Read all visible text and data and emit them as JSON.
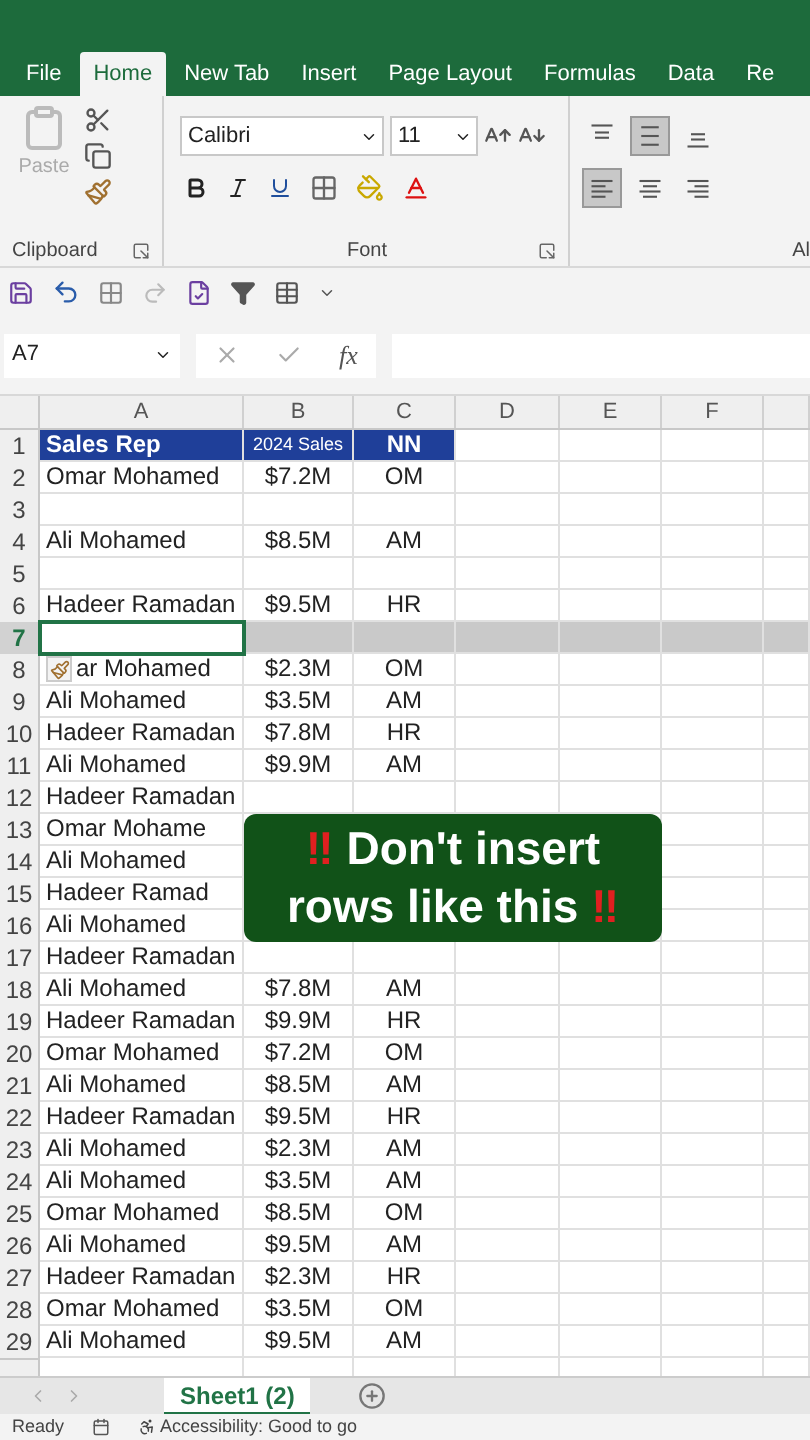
{
  "tabs": [
    {
      "label": "File",
      "selected": false
    },
    {
      "label": "Home",
      "selected": true
    },
    {
      "label": "New Tab",
      "selected": false
    },
    {
      "label": "Insert",
      "selected": false
    },
    {
      "label": "Page Layout",
      "selected": false
    },
    {
      "label": "Formulas",
      "selected": false
    },
    {
      "label": "Data",
      "selected": false
    },
    {
      "label": "Re",
      "selected": false
    }
  ],
  "ribbon": {
    "clipboard": {
      "paste_label": "Paste",
      "paste_disabled": true,
      "group_label": "Clipboard"
    },
    "font": {
      "name": "Calibri",
      "size": "11",
      "group_label": "Font"
    },
    "alignment": {
      "vertical": [
        {
          "kind": "top",
          "selected": false
        },
        {
          "kind": "middle",
          "selected": true
        },
        {
          "kind": "bottom",
          "selected": false
        }
      ],
      "horizontal": [
        {
          "kind": "left",
          "selected": true
        },
        {
          "kind": "center",
          "selected": false
        },
        {
          "kind": "right",
          "selected": false
        }
      ],
      "group_label": "Al"
    }
  },
  "formula_bar": {
    "name_box": "A7",
    "fx": "fx"
  },
  "columns": [
    "A",
    "B",
    "C",
    "D",
    "E",
    "F"
  ],
  "rows": [
    {
      "number": "1",
      "kind": "header",
      "selected": false,
      "cells": [
        "Sales Rep",
        "2024 Sales",
        "NN"
      ]
    },
    {
      "number": "2",
      "kind": "data",
      "selected": false,
      "cells": [
        "Omar Mohamed",
        "$7.2M",
        "OM"
      ]
    },
    {
      "number": "3",
      "kind": "data",
      "selected": false,
      "cells": []
    },
    {
      "number": "4",
      "kind": "data",
      "selected": false,
      "cells": [
        "Ali Mohamed",
        "$8.5M",
        "AM"
      ]
    },
    {
      "number": "5",
      "kind": "data",
      "selected": false,
      "cells": []
    },
    {
      "number": "6",
      "kind": "data",
      "selected": false,
      "cells": [
        "Hadeer Ramadan",
        "$9.5M",
        "HR"
      ]
    },
    {
      "number": "7",
      "kind": "data",
      "selected": true,
      "cells": []
    },
    {
      "number": "8",
      "kind": "marked",
      "selected": false,
      "cells": [
        "ar Mohamed",
        "$2.3M",
        "OM"
      ]
    },
    {
      "number": "9",
      "kind": "data",
      "selected": false,
      "cells": [
        "Ali Mohamed",
        "$3.5M",
        "AM"
      ]
    },
    {
      "number": "10",
      "kind": "data",
      "selected": false,
      "cells": [
        "Hadeer Ramadan",
        "$7.8M",
        "HR"
      ]
    },
    {
      "number": "11",
      "kind": "data",
      "selected": false,
      "cells": [
        "Ali Mohamed",
        "$9.9M",
        "AM"
      ]
    },
    {
      "number": "12",
      "kind": "data",
      "selected": false,
      "cells": [
        "Hadeer Ramadan"
      ]
    },
    {
      "number": "13",
      "kind": "data",
      "selected": false,
      "cells": [
        "Omar Mohame"
      ]
    },
    {
      "number": "14",
      "kind": "data",
      "selected": false,
      "cells": [
        "Ali Mohamed"
      ]
    },
    {
      "number": "15",
      "kind": "data",
      "selected": false,
      "cells": [
        "Hadeer Ramad"
      ]
    },
    {
      "number": "16",
      "kind": "data",
      "selected": false,
      "cells": [
        "Ali Mohamed"
      ]
    },
    {
      "number": "17",
      "kind": "data",
      "selected": false,
      "cells": [
        "Hadeer Ramadan"
      ]
    },
    {
      "number": "18",
      "kind": "data",
      "selected": false,
      "cells": [
        "Ali Mohamed",
        "$7.8M",
        "AM"
      ]
    },
    {
      "number": "19",
      "kind": "data",
      "selected": false,
      "cells": [
        "Hadeer Ramadan",
        "$9.9M",
        "HR"
      ]
    },
    {
      "number": "20",
      "kind": "data",
      "selected": false,
      "cells": [
        "Omar Mohamed",
        "$7.2M",
        "OM"
      ]
    },
    {
      "number": "21",
      "kind": "data",
      "selected": false,
      "cells": [
        "Ali Mohamed",
        "$8.5M",
        "AM"
      ]
    },
    {
      "number": "22",
      "kind": "data",
      "selected": false,
      "cells": [
        "Hadeer Ramadan",
        "$9.5M",
        "HR"
      ]
    },
    {
      "number": "23",
      "kind": "data",
      "selected": false,
      "cells": [
        "Ali Mohamed",
        "$2.3M",
        "AM"
      ]
    },
    {
      "number": "24",
      "kind": "data",
      "selected": false,
      "cells": [
        "Ali Mohamed",
        "$3.5M",
        "AM"
      ]
    },
    {
      "number": "25",
      "kind": "data",
      "selected": false,
      "cells": [
        "Omar Mohamed",
        "$8.5M",
        "OM"
      ]
    },
    {
      "number": "26",
      "kind": "data",
      "selected": false,
      "cells": [
        "Ali Mohamed",
        "$9.5M",
        "AM"
      ]
    },
    {
      "number": "27",
      "kind": "data",
      "selected": false,
      "cells": [
        "Hadeer Ramadan",
        "$2.3M",
        "HR"
      ]
    },
    {
      "number": "28",
      "kind": "data",
      "selected": false,
      "cells": [
        "Omar Mohamed",
        "$3.5M",
        "OM"
      ]
    },
    {
      "number": "29",
      "kind": "data",
      "selected": false,
      "cells": [
        "Ali Mohamed",
        "$9.5M",
        "AM"
      ]
    }
  ],
  "caption": {
    "lead_mark": "‼",
    "lines": [
      "Don't insert",
      "rows like this"
    ],
    "trail_mark": "‼"
  },
  "sheet_tabs": [
    {
      "label": "Sheet1 (2)",
      "selected": true
    }
  ],
  "status_bar": {
    "mode": "Ready",
    "accessibility": "Accessibility: Good to go"
  }
}
